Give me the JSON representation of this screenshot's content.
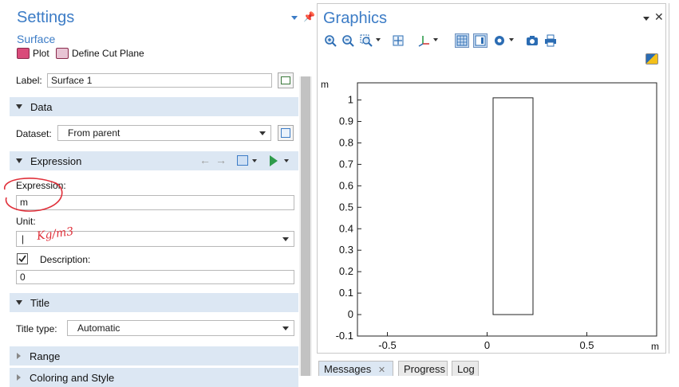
{
  "settings": {
    "title": "Settings",
    "subtitle": "Surface",
    "toolbar": {
      "plot_label": "Plot",
      "cut_plane_label": "Define Cut Plane"
    },
    "label_field": {
      "label": "Label:",
      "value": "Surface 1"
    },
    "data_section": {
      "title": "Data",
      "dataset_label": "Dataset:",
      "dataset_value": "From parent"
    },
    "expression_section": {
      "title": "Expression",
      "expression_label": "Expression:",
      "expression_value": "m",
      "unit_label": "Unit:",
      "unit_value": "|",
      "description_label": "Description:",
      "description_checked": true,
      "description_value": "0"
    },
    "title_section": {
      "title": "Title",
      "title_type_label": "Title type:",
      "title_type_value": "Automatic"
    },
    "range_section": {
      "title": "Range"
    },
    "coloring_section": {
      "title": "Coloring and Style"
    },
    "annotation": {
      "handwritten_text": "Kg/m3"
    }
  },
  "graphics": {
    "title": "Graphics",
    "y_unit": "m",
    "x_unit": "m",
    "y_ticks": [
      "1",
      "0.9",
      "0.8",
      "0.7",
      "0.6",
      "0.5",
      "0.4",
      "0.3",
      "0.2",
      "0.1",
      "0",
      "-0.1"
    ],
    "x_ticks": [
      "-0.5",
      "0",
      "0.5"
    ]
  },
  "chart_data": {
    "type": "scatter",
    "xlim": [
      -0.65,
      0.85
    ],
    "ylim": [
      -0.1,
      1.08
    ],
    "y_tick_values": [
      1,
      0.9,
      0.8,
      0.7,
      0.6,
      0.5,
      0.4,
      0.3,
      0.2,
      0.1,
      0,
      -0.1
    ],
    "x_tick_values": [
      -0.5,
      0,
      0.5
    ],
    "rectangle": {
      "x_min": 0.03,
      "x_max": 0.23,
      "y_min": 0,
      "y_max": 1.01
    }
  },
  "bottom_tabs": [
    "Messages",
    "Progress",
    "Log"
  ],
  "colors": {
    "accent": "#3c7cc6",
    "section_bg": "#dce7f3",
    "annotation_red": "#e0303a"
  }
}
